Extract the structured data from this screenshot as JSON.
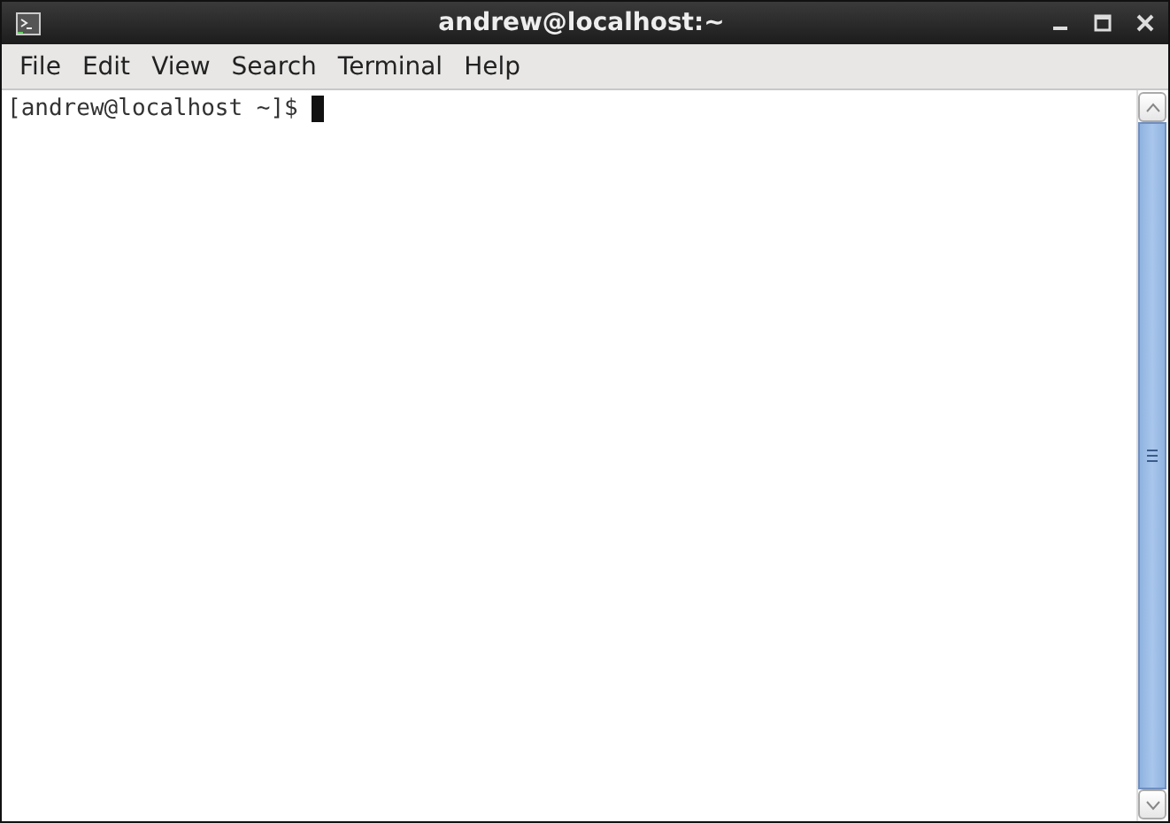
{
  "window": {
    "title": "andrew@localhost:~"
  },
  "menu": [
    "File",
    "Edit",
    "View",
    "Search",
    "Terminal",
    "Help"
  ],
  "terminal": {
    "lines": [
      "[andrew@localhost ~]$ "
    ]
  }
}
